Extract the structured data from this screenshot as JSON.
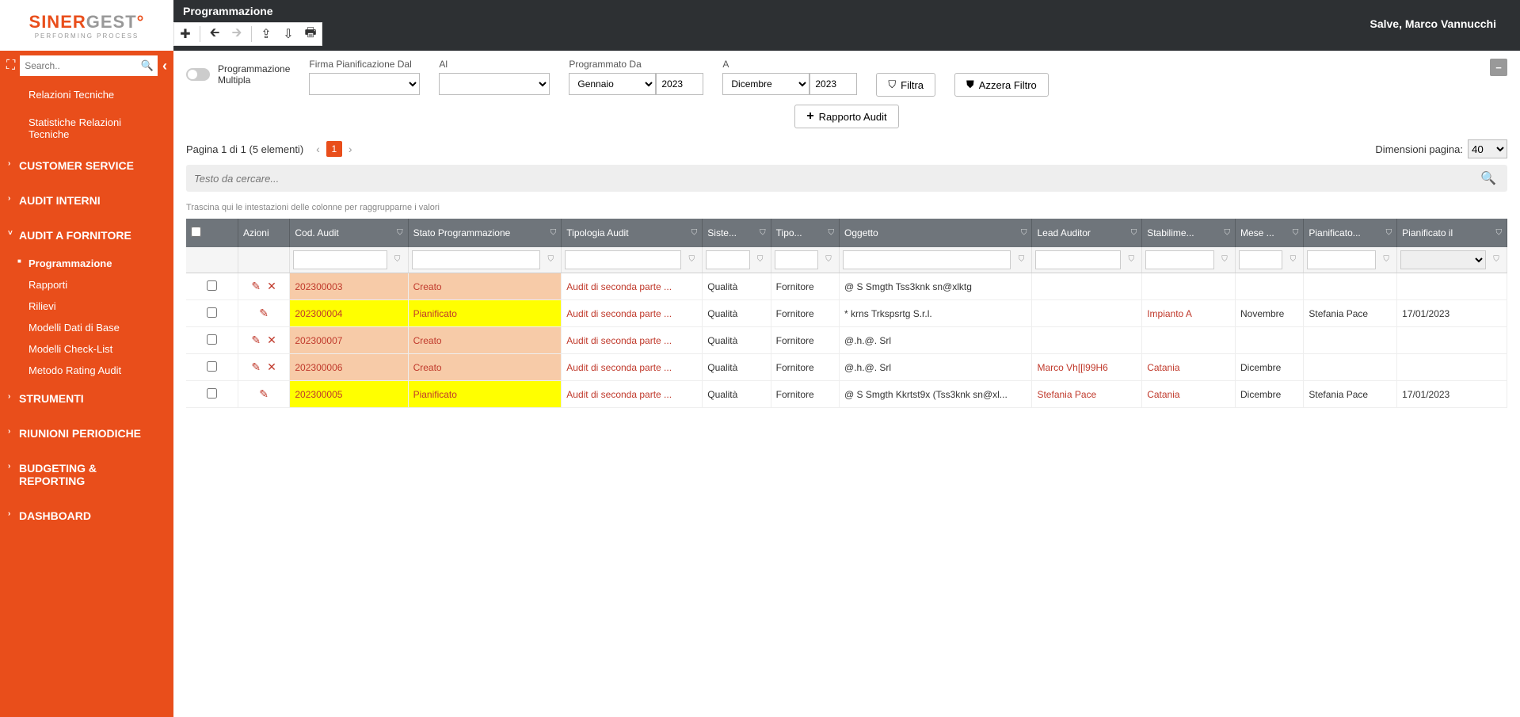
{
  "app": {
    "logo1": "SINER",
    "logo2": "GEST",
    "logoSub": "PERFORMING PROCESS",
    "pageTitle": "Programmazione",
    "greeting": "Salve, Marco Vannucchi"
  },
  "sidebar": {
    "searchPlaceholder": "Search..",
    "items": [
      {
        "label": "Relazioni Tecniche",
        "type": "sub"
      },
      {
        "label": "Statistiche Relazioni Tecniche",
        "type": "sub"
      },
      {
        "label": "CUSTOMER SERVICE",
        "type": "top"
      },
      {
        "label": "AUDIT INTERNI",
        "type": "top"
      },
      {
        "label": "AUDIT A FORNITORE",
        "type": "top",
        "expanded": true
      },
      {
        "label": "Programmazione",
        "type": "sub2",
        "active": true
      },
      {
        "label": "Rapporti",
        "type": "sub2"
      },
      {
        "label": "Rilievi",
        "type": "sub2"
      },
      {
        "label": "Modelli Dati di Base",
        "type": "sub2"
      },
      {
        "label": "Modelli Check-List",
        "type": "sub2"
      },
      {
        "label": "Metodo Rating Audit",
        "type": "sub2"
      },
      {
        "label": "STRUMENTI",
        "type": "top"
      },
      {
        "label": "RIUNIONI PERIODICHE",
        "type": "top"
      },
      {
        "label": "BUDGETING & REPORTING",
        "type": "top"
      },
      {
        "label": "DASHBOARD",
        "type": "top"
      }
    ]
  },
  "filters": {
    "multiLabel1": "Programmazione",
    "multiLabel2": "Multipla",
    "firmaDal": "Firma Pianificazione Dal",
    "al": "Al",
    "progDa": "Programmato Da",
    "a": "A",
    "monthFrom": "Gennaio",
    "yearFrom": "2023",
    "monthTo": "Dicembre",
    "yearTo": "2023",
    "filtra": "Filtra",
    "azzera": "Azzera Filtro",
    "rapporto": "Rapporto Audit"
  },
  "pager": {
    "info": "Pagina 1 di 1 (5 elementi)",
    "current": "1",
    "sizeLabel": "Dimensioni pagina:",
    "size": "40"
  },
  "table": {
    "searchPlaceholder": "Testo da cercare...",
    "groupHint": "Trascina qui le intestazioni delle colonne per raggrupparne i valori",
    "headers": {
      "azioni": "Azioni",
      "cod": "Cod. Audit",
      "stato": "Stato Programmazione",
      "tipologia": "Tipologia Audit",
      "siste": "Siste...",
      "tipo": "Tipo...",
      "oggetto": "Oggetto",
      "lead": "Lead Auditor",
      "stab": "Stabilime...",
      "mese": "Mese ...",
      "pianif": "Pianificato...",
      "pianifIl": "Pianificato il"
    },
    "rows": [
      {
        "status": "Creato",
        "cls": "creato",
        "edit": true,
        "del": true,
        "cod": "202300003",
        "tipo": "Audit di seconda parte ...",
        "sist": "Qualità",
        "tipoa": "Fornitore",
        "ogg": "@ S Smgth Tss3knk sn@xlktg",
        "lead": "",
        "stab": "",
        "mese": "",
        "pian": "",
        "pianil": ""
      },
      {
        "status": "Pianificato",
        "cls": "pianif",
        "edit": true,
        "del": false,
        "cod": "202300004",
        "tipo": "Audit di seconda parte ...",
        "sist": "Qualità",
        "tipoa": "Fornitore",
        "ogg": "* krns Trkspsrtg S.r.l.",
        "lead": "",
        "stab": "Impianto A",
        "mese": "Novembre",
        "pian": "Stefania Pace",
        "pianil": "17/01/2023"
      },
      {
        "status": "Creato",
        "cls": "creato",
        "edit": true,
        "del": true,
        "cod": "202300007",
        "tipo": "Audit di seconda parte ...",
        "sist": "Qualità",
        "tipoa": "Fornitore",
        "ogg": "@.h.@. Srl",
        "lead": "",
        "stab": "",
        "mese": "",
        "pian": "",
        "pianil": ""
      },
      {
        "status": "Creato",
        "cls": "creato",
        "edit": true,
        "del": true,
        "cod": "202300006",
        "tipo": "Audit di seconda parte ...",
        "sist": "Qualità",
        "tipoa": "Fornitore",
        "ogg": "@.h.@. Srl",
        "lead": "Marco Vh[[l99H6",
        "stab": "Catania",
        "mese": "Dicembre",
        "pian": "",
        "pianil": ""
      },
      {
        "status": "Pianificato",
        "cls": "pianif",
        "edit": true,
        "del": false,
        "cod": "202300005",
        "tipo": "Audit di seconda parte ...",
        "sist": "Qualità",
        "tipoa": "Fornitore",
        "ogg": "@ S Smgth Kkrtst9x (Tss3knk sn@xl...",
        "lead": "Stefania Pace",
        "stab": "Catania",
        "mese": "Dicembre",
        "pian": "Stefania Pace",
        "pianil": "17/01/2023"
      }
    ]
  }
}
